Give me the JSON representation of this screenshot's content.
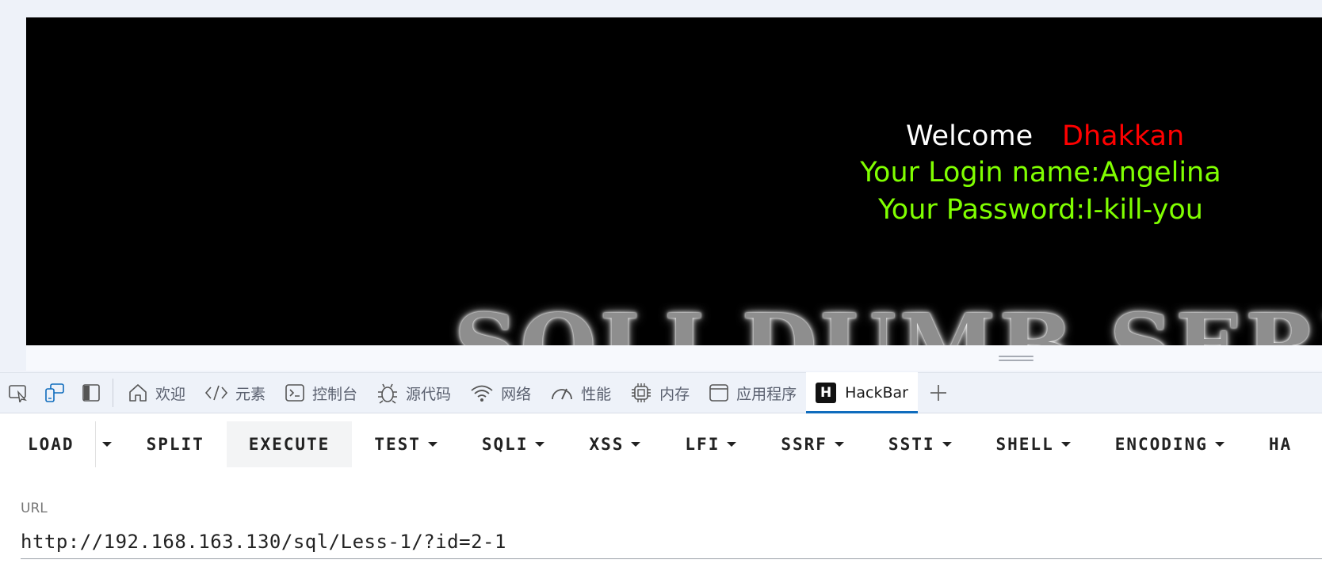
{
  "page": {
    "welcome_word": "Welcome",
    "welcome_name": "Dhakkan",
    "login_line": "Your Login name:Angelina",
    "password_line": "Your Password:I-kill-you",
    "banner_text": "SQLI DUMB SERIES",
    "colors": {
      "background": "#000000",
      "welcome": "#ffffff",
      "name": "#ff0000",
      "credentials": "#80ff00"
    }
  },
  "devtools": {
    "tools": [
      {
        "icon": "inspect-element-icon"
      },
      {
        "icon": "device-emulation-icon"
      },
      {
        "icon": "dock-side-icon"
      }
    ],
    "tabs": [
      {
        "label": "欢迎",
        "icon": "home-icon"
      },
      {
        "label": "元素",
        "icon": "code-brackets-icon"
      },
      {
        "label": "控制台",
        "icon": "console-icon"
      },
      {
        "label": "源代码",
        "icon": "bug-icon"
      },
      {
        "label": "网络",
        "icon": "wifi-icon"
      },
      {
        "label": "性能",
        "icon": "gauge-icon"
      },
      {
        "label": "内存",
        "icon": "chip-icon"
      },
      {
        "label": "应用程序",
        "icon": "window-icon"
      },
      {
        "label": "HackBar",
        "icon": "hackbar-logo-icon",
        "active": true
      }
    ],
    "accent": "#0f6cbd"
  },
  "hackbar": {
    "logo_letter": "H",
    "menu": {
      "load": "LOAD",
      "split": "SPLIT",
      "execute": "EXECUTE",
      "test": "TEST",
      "sqli": "SQLI",
      "xss": "XSS",
      "lfi": "LFI",
      "ssrf": "SSRF",
      "ssti": "SSTI",
      "shell": "SHELL",
      "encoding": "ENCODING",
      "hash_partial": "HA"
    },
    "url_label": "URL",
    "url_value": "http://192.168.163.130/sql/Less-1/?id=2-1"
  }
}
